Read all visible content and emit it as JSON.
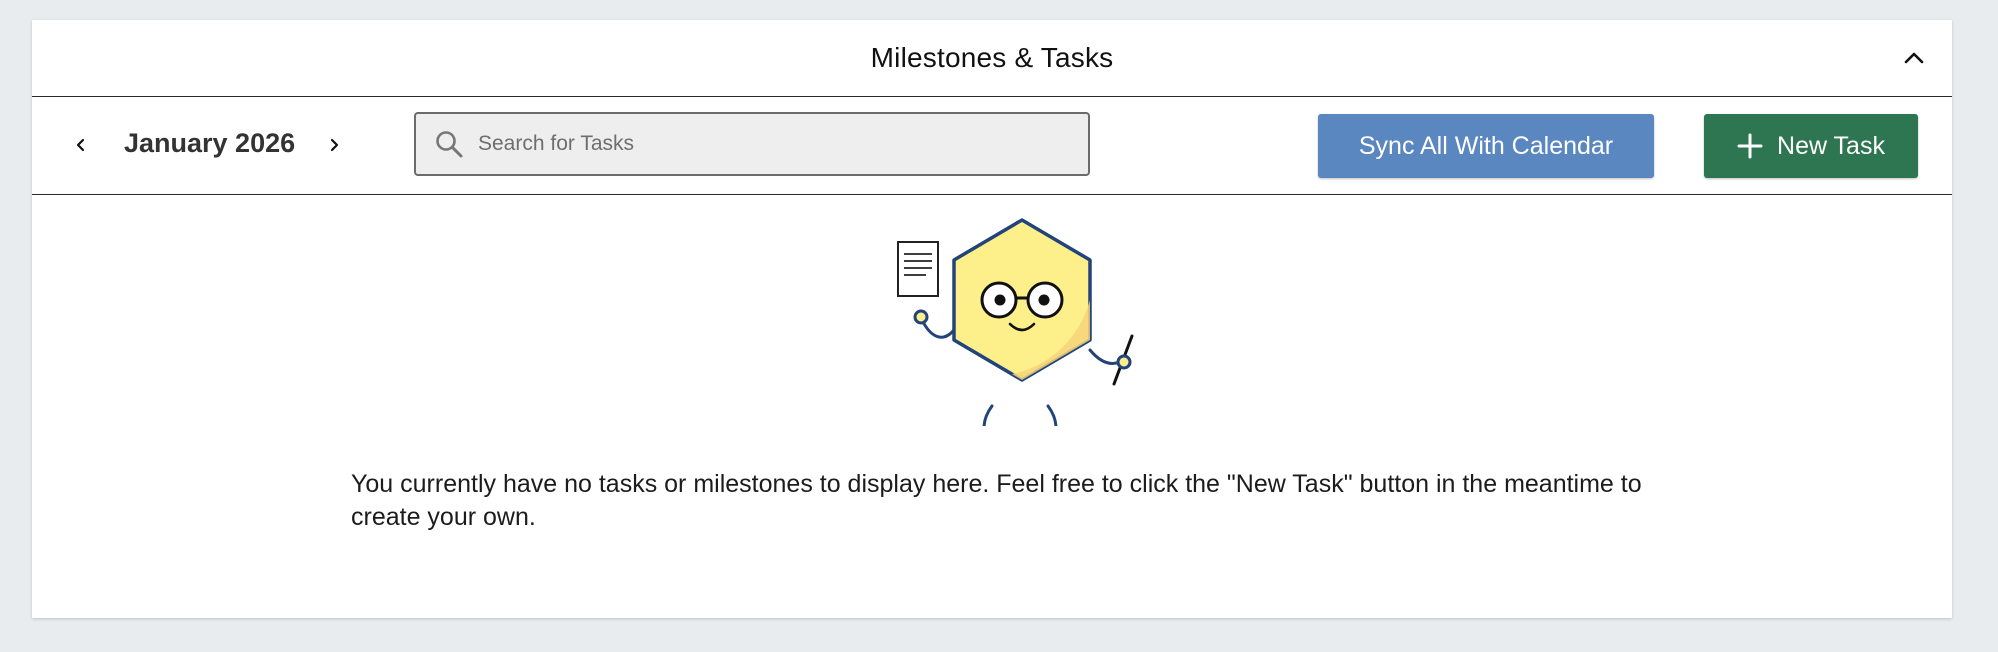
{
  "header": {
    "title": "Milestones & Tasks",
    "collapse_icon": "chevron-up-icon"
  },
  "toolbar": {
    "month_label": "January 2026",
    "prev_icon": "chevron-left-icon",
    "next_icon": "chevron-right-icon",
    "search": {
      "placeholder": "Search for Tasks",
      "value": "",
      "icon": "search-icon"
    },
    "sync_button_label": "Sync All With Calendar",
    "new_task_button_label": "New Task",
    "new_task_icon": "plus-icon"
  },
  "empty_state": {
    "message": "You currently have no tasks or milestones to display here. Feel free to click the \"New Task\" button in the meantime to create your own.",
    "illustration": "hexagon-mascot-with-glasses"
  },
  "colors": {
    "sync_button": "#5b87c0",
    "new_task_button": "#2e7551",
    "mascot_fill": "#fdf08a",
    "mascot_outline": "#22447a"
  }
}
